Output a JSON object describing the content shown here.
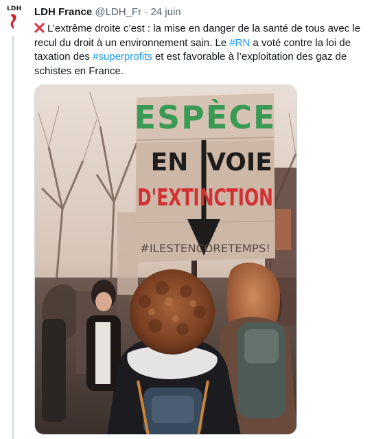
{
  "tweet": {
    "author_name": "LDH France",
    "author_handle": "@LDH_Fr",
    "separator": "·",
    "date": "24 juin",
    "avatar_logo_text": "LDH",
    "text_part1": "L’extrême droite c’est : la mise en danger de la santé de tous avec le recul du droit à un environnement sain. Le ",
    "hashtag1": "#RN",
    "text_part2": " a voté contre la loi de taxation des ",
    "hashtag2": "#superprofits",
    "text_part3": " et est favorable à l’exploitation des gaz de schistes en France.",
    "emoji_icon": "cross-mark-icon"
  },
  "photo": {
    "sign_line1": "ESPÈCE",
    "sign_line2a": "EN",
    "sign_line2b": "VOIE",
    "sign_line3": "D'EXTINCTION",
    "sign_line4": "#ILESTENCOREТЕМPS!",
    "colors": {
      "green": "#3a9a55",
      "black": "#1f1d1b",
      "red": "#d23134",
      "cardboard": "#cdb7a6"
    }
  },
  "theme": {
    "link_color": "#1d9bf0",
    "secondary_text": "#536471",
    "cross_color": "#dd2e44"
  }
}
